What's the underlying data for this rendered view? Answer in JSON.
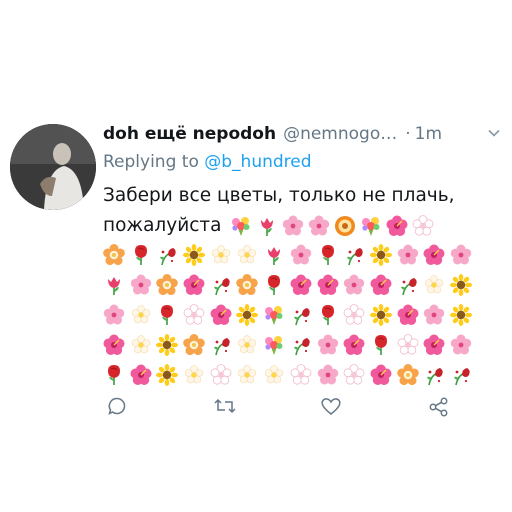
{
  "tweet": {
    "display_name": "doh ещё nepodoh",
    "handle": "@nemnogo…",
    "separator": "·",
    "time": "1m",
    "replying_prefix": "Replying to",
    "replying_handle": "@b_hundred",
    "text_line1": "Забери все цветы, только не плачь,",
    "text_line2": "пожалуйста",
    "text_line2_emojis": [
      "bouquet",
      "tulip",
      "cherry-blossom",
      "cherry-blossom",
      "sunflower-orange",
      "bouquet",
      "hibiscus",
      "white-flower"
    ],
    "emoji_rows": [
      [
        "blossom",
        "rose",
        "wilted-rose",
        "sunflower",
        "blossom-white",
        "blossom-white",
        "tulip",
        "cherry-blossom",
        "rose",
        "wilted-rose",
        "sunflower",
        "cherry-blossom",
        "hibiscus",
        "cherry-blossom"
      ],
      [
        "tulip",
        "cherry-blossom",
        "blossom",
        "hibiscus",
        "wilted-rose",
        "blossom",
        "rose",
        "hibiscus",
        "hibiscus",
        "cherry-blossom",
        "hibiscus",
        "wilted-rose",
        "blossom-white",
        "sunflower"
      ],
      [
        "cherry-blossom",
        "blossom-white",
        "rose",
        "white-flower",
        "hibiscus",
        "sunflower",
        "bouquet",
        "wilted-rose",
        "rose",
        "white-flower",
        "sunflower",
        "hibiscus",
        "cherry-blossom",
        "sunflower"
      ],
      [
        "hibiscus",
        "blossom-white",
        "sunflower",
        "blossom",
        "wilted-rose",
        "blossom-white",
        "bouquet",
        "wilted-rose",
        "cherry-blossom",
        "hibiscus",
        "rose",
        "white-flower",
        "hibiscus",
        "cherry-blossom"
      ],
      [
        "rose",
        "hibiscus",
        "sunflower",
        "blossom-white",
        "white-flower",
        "blossom-white",
        "blossom-white",
        "white-flower",
        "cherry-blossom",
        "white-flower",
        "hibiscus",
        "blossom",
        "wilted-rose",
        "wilted-rose"
      ]
    ]
  },
  "actions": {
    "reply_icon": "reply-icon",
    "retweet_icon": "retweet-icon",
    "like_icon": "heart-icon",
    "share_icon": "share-icon"
  },
  "colors": {
    "secondary": "#657786",
    "link": "#1da1f2",
    "text": "#14171a"
  }
}
